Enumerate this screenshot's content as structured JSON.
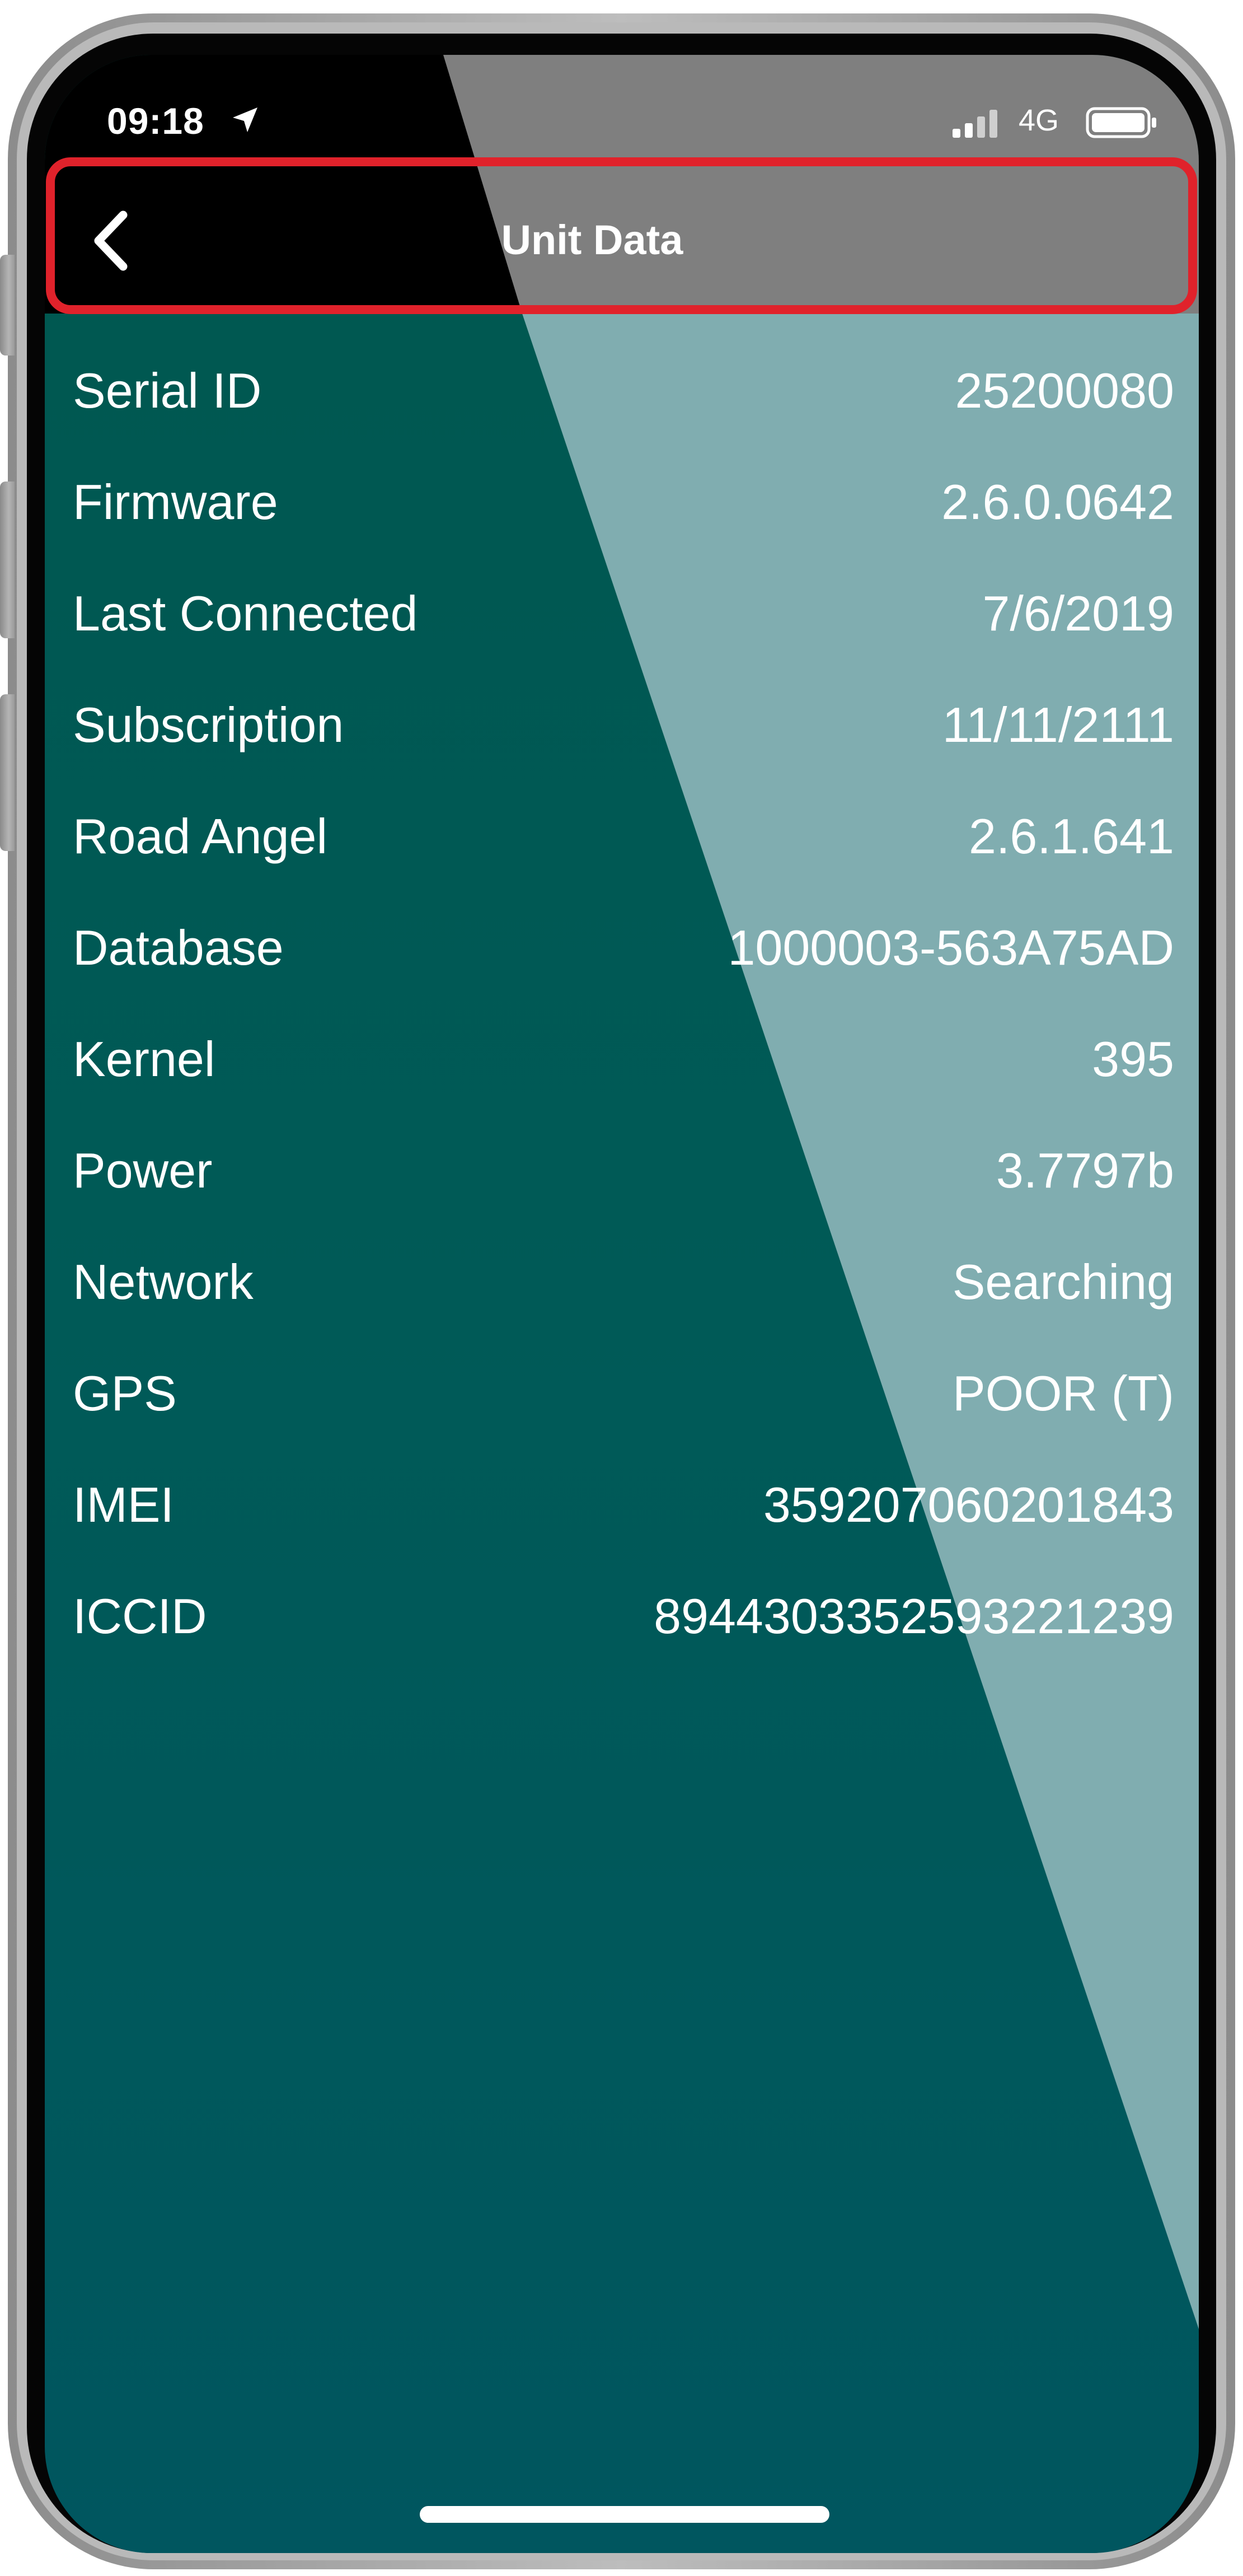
{
  "status_bar": {
    "time": "09:18",
    "network": "4G",
    "icons": [
      "location-arrow-icon",
      "cellular-signal-icon",
      "battery-icon"
    ]
  },
  "nav_bar": {
    "title": "Unit Data",
    "back_icon": "chevron-left-icon"
  },
  "unit_data": [
    {
      "label": "Serial ID",
      "value": "25200080"
    },
    {
      "label": "Firmware",
      "value": "2.6.0.0642"
    },
    {
      "label": "Last Connected",
      "value": "7/6/2019"
    },
    {
      "label": "Subscription",
      "value": "11/11/2111"
    },
    {
      "label": "Road Angel",
      "value": "2.6.1.641"
    },
    {
      "label": "Database",
      "value": "1000003-563A75AD"
    },
    {
      "label": "Kernel",
      "value": "395"
    },
    {
      "label": "Power",
      "value": "3.7797b"
    },
    {
      "label": "Network",
      "value": "Searching"
    },
    {
      "label": "GPS",
      "value": "POOR (T)"
    },
    {
      "label": "IMEI",
      "value": "359207060201843"
    },
    {
      "label": "ICCID",
      "value": "8944303352593221239"
    }
  ],
  "colors": {
    "background_teal": "#005a55",
    "light_overlay": "#80adb0",
    "header_gray": "#808080",
    "highlight_red": "#e0222b"
  }
}
